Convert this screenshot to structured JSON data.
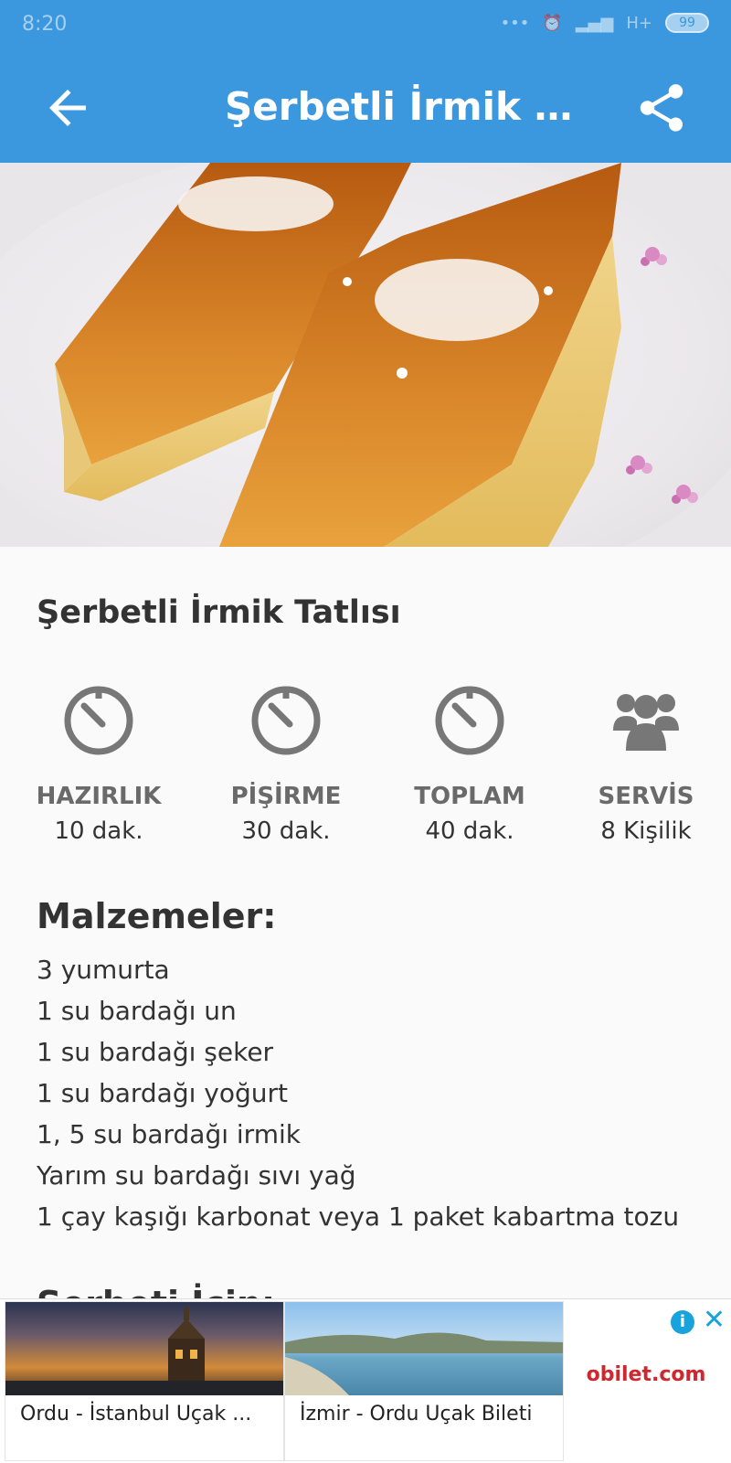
{
  "status_bar": {
    "time": "8:20",
    "network": "H+",
    "battery": "99"
  },
  "app_bar": {
    "title": "Şerbetli İrmik Tatlısı"
  },
  "recipe": {
    "title": "Şerbetli İrmik Tatlısı",
    "stats": [
      {
        "icon": "timer-icon",
        "label": "HAZIRLIK",
        "value": "10 dak."
      },
      {
        "icon": "timer-icon",
        "label": "PİŞİRME",
        "value": "30 dak."
      },
      {
        "icon": "timer-icon",
        "label": "TOPLAM",
        "value": "40 dak."
      },
      {
        "icon": "people-icon",
        "label": "SERVİS",
        "value": "8 Kişilik"
      }
    ],
    "ingredients_title": "Malzemeler:",
    "ingredients": [
      "3 yumurta",
      "1 su bardağı un",
      "1 su bardağı şeker",
      "1 su bardağı yoğurt",
      "1, 5 su bardağı irmik",
      "Yarım su bardağı sıvı yağ",
      "1 çay kaşığı karbonat veya 1 paket kabartma tozu"
    ],
    "next_section_title": "Şerbeti İçin:"
  },
  "ad": {
    "cards": [
      {
        "caption": "Ordu - İstanbul Uçak ..."
      },
      {
        "caption": "İzmir - Ordu Uçak Bileti"
      }
    ],
    "brand": "obilet.com",
    "info_icon": "i",
    "close_icon": "✕"
  },
  "colors": {
    "primary": "#3b97de",
    "icon_gray": "#777777",
    "brand_red": "#d0262d"
  }
}
